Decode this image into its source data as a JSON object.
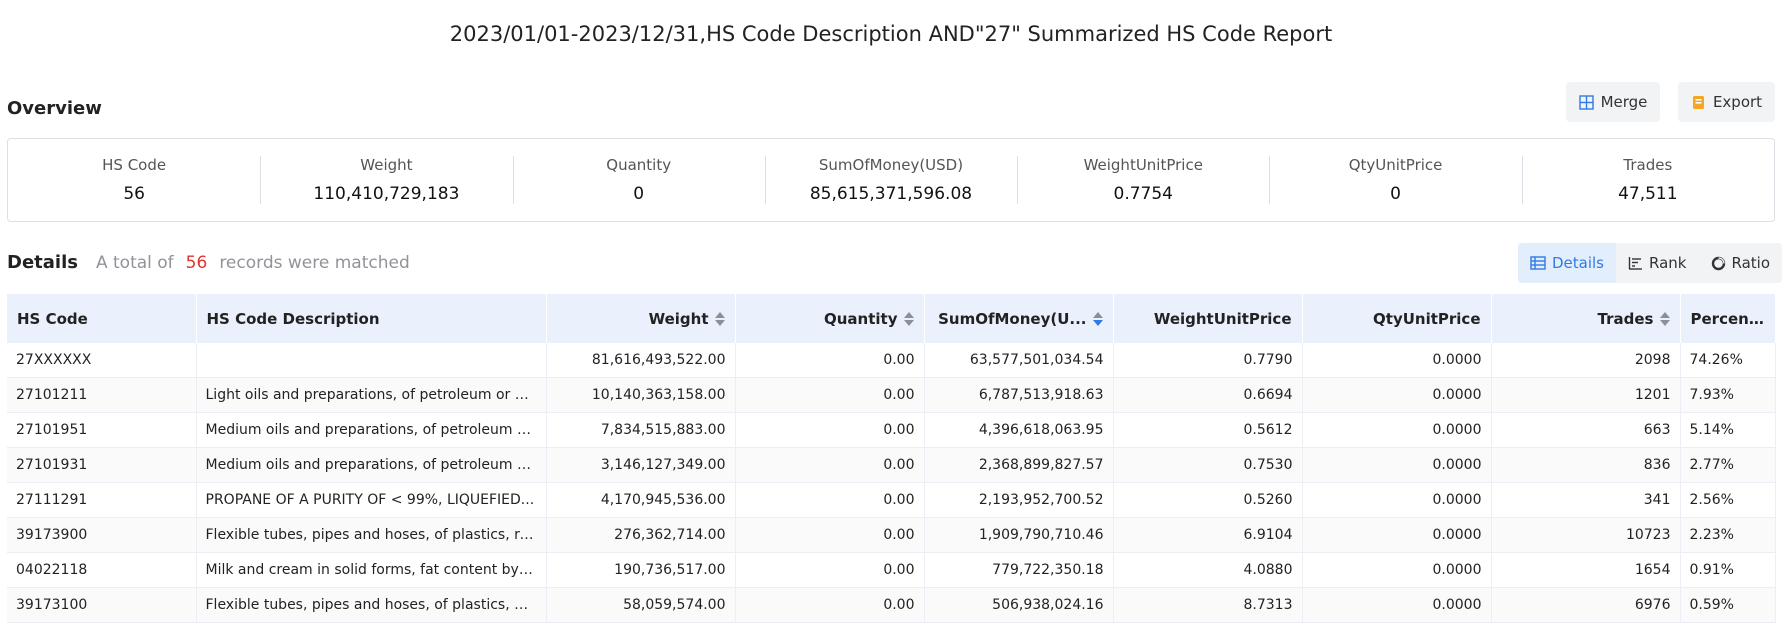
{
  "report_title": "2023/01/01-2023/12/31,HS Code Description AND\"27\" Summarized HS Code Report",
  "overview": {
    "title": "Overview",
    "merge_label": "Merge",
    "export_label": "Export",
    "stats": [
      {
        "label": "HS Code",
        "value": "56"
      },
      {
        "label": "Weight",
        "value": "110,410,729,183"
      },
      {
        "label": "Quantity",
        "value": "0"
      },
      {
        "label": "SumOfMoney(USD)",
        "value": "85,615,371,596.08"
      },
      {
        "label": "WeightUnitPrice",
        "value": "0.7754"
      },
      {
        "label": "QtyUnitPrice",
        "value": "0"
      },
      {
        "label": "Trades",
        "value": "47,511"
      }
    ]
  },
  "details": {
    "title": "Details",
    "prefix": "A total of",
    "count": "56",
    "suffix": "records were matched",
    "views": {
      "details": "Details",
      "rank": "Rank",
      "ratio": "Ratio"
    },
    "accent": "#2f7ae5"
  },
  "table": {
    "columns": [
      "HS Code",
      "HS Code Description",
      "Weight",
      "Quantity",
      "SumOfMoney(U...",
      "WeightUnitPrice",
      "QtyUnitPrice",
      "Trades",
      "Percen..."
    ],
    "rows": [
      [
        "27XXXXXX",
        "",
        "81,616,493,522.00",
        "0.00",
        "63,577,501,034.54",
        "0.7790",
        "0.0000",
        "2098",
        "74.26%"
      ],
      [
        "27101211",
        "Light oils and preparations, of petroleum or bit...",
        "10,140,363,158.00",
        "0.00",
        "6,787,513,918.63",
        "0.6694",
        "0.0000",
        "1201",
        "7.93%"
      ],
      [
        "27101951",
        "Medium oils and preparations, of petroleum or ...",
        "7,834,515,883.00",
        "0.00",
        "4,396,618,063.95",
        "0.5612",
        "0.0000",
        "663",
        "5.14%"
      ],
      [
        "27101931",
        "Medium oils and preparations, of petroleum or ...",
        "3,146,127,349.00",
        "0.00",
        "2,368,899,827.57",
        "0.7530",
        "0.0000",
        "836",
        "2.77%"
      ],
      [
        "27111291",
        "PROPANE OF A PURITY OF < 99%, LIQUEFIED...",
        "4,170,945,536.00",
        "0.00",
        "2,193,952,700.52",
        "0.5260",
        "0.0000",
        "341",
        "2.56%"
      ],
      [
        "39173900",
        "Flexible tubes, pipes and hoses, of plastics, rein...",
        "276,362,714.00",
        "0.00",
        "1,909,790,710.46",
        "6.9104",
        "0.0000",
        "10723",
        "2.23%"
      ],
      [
        "04022118",
        "Milk and cream in solid forms, fat content by w...",
        "190,736,517.00",
        "0.00",
        "779,722,350.18",
        "4.0880",
        "0.0000",
        "1654",
        "0.91%"
      ],
      [
        "39173100",
        "Flexible tubes, pipes and hoses, of plastics, bur...",
        "58,059,574.00",
        "0.00",
        "506,938,024.16",
        "8.7313",
        "0.0000",
        "6976",
        "0.59%"
      ]
    ]
  }
}
